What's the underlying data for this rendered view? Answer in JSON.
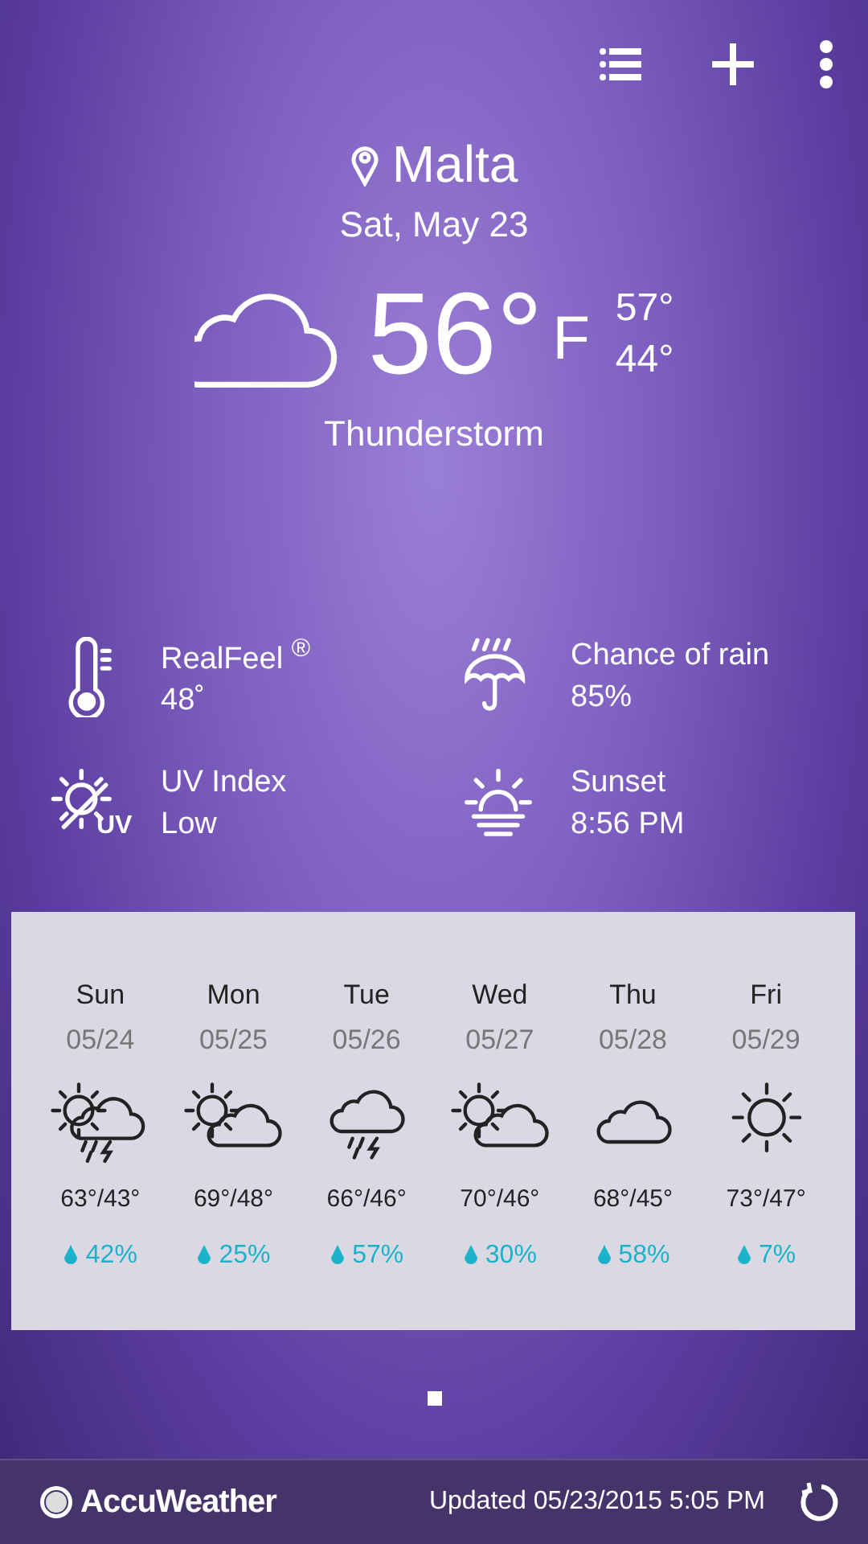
{
  "location": {
    "name": "Malta",
    "date": "Sat, May 23"
  },
  "current": {
    "kind": "cloudy",
    "temp": "56°",
    "unit": "F",
    "high": "57°",
    "low": "44°",
    "condition": "Thunderstorm"
  },
  "details": [
    {
      "kind": "thermometer",
      "label": "RealFeel $^{®}$",
      "value": "48˚"
    },
    {
      "kind": "umbrella",
      "label": "Chance of rain",
      "value": "85%"
    },
    {
      "kind": "uv",
      "badge": "UV",
      "label": "UV Index",
      "value": "Low"
    },
    {
      "kind": "sunset",
      "label": "Sunset",
      "value": "8:56 PM"
    }
  ],
  "forecast": [
    {
      "day": "Sun",
      "date": "05/24",
      "kind": "sun-storm",
      "temps": "63°/43°",
      "rain": "42%"
    },
    {
      "day": "Mon",
      "date": "05/25",
      "kind": "partly-cloudy",
      "temps": "69°/48°",
      "rain": "25%"
    },
    {
      "day": "Tue",
      "date": "05/26",
      "kind": "storm",
      "temps": "66°/46°",
      "rain": "57%"
    },
    {
      "day": "Wed",
      "date": "05/27",
      "kind": "partly-cloudy",
      "temps": "70°/46°",
      "rain": "30%"
    },
    {
      "day": "Thu",
      "date": "05/28",
      "kind": "cloudy",
      "temps": "68°/45°",
      "rain": "58%"
    },
    {
      "day": "Fri",
      "date": "05/29",
      "kind": "sunny",
      "temps": "73°/47°",
      "rain": "7%"
    }
  ],
  "pages": [
    {
      "selected": true
    }
  ],
  "footer": {
    "brand": "AccuWeather",
    "updated": "Updated 05/23/2015 5:05 PM"
  }
}
